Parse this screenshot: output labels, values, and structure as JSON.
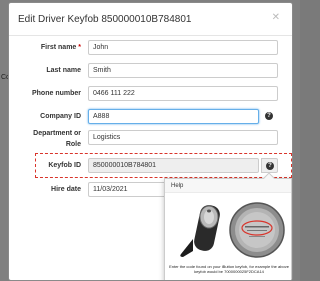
{
  "background": {
    "partial_text": "Co"
  },
  "modal": {
    "title": "Edit Driver Keyfob 850000010B784801",
    "close_icon": "close-x-icon"
  },
  "form": {
    "first_name": {
      "label": "First name",
      "required_mark": "*",
      "value": "John"
    },
    "last_name": {
      "label": "Last name",
      "value": "Smith"
    },
    "phone": {
      "label": "Phone number",
      "value": "0466 111 222"
    },
    "company_id": {
      "label": "Company ID",
      "value": "A888",
      "help_icon": "question-circle-icon"
    },
    "department": {
      "label": "Department or Role",
      "value": "Logistics"
    },
    "keyfob_id": {
      "label": "Keyfob ID",
      "value": "850000010B784801",
      "help_icon": "question-circle-icon"
    },
    "hire_date": {
      "label": "Hire date",
      "value": "11/03/2021"
    }
  },
  "help_popover": {
    "title": "Help",
    "caption": "Enter the code found on your iButton keyfob, for example the above keyfob would be 7000000025F2DCA14",
    "images": [
      "ibutton-keyfob-image",
      "ibutton-code-image"
    ]
  },
  "colors": {
    "highlight": "#d9342b",
    "focus": "#66afe9",
    "required": "#cc0000"
  }
}
